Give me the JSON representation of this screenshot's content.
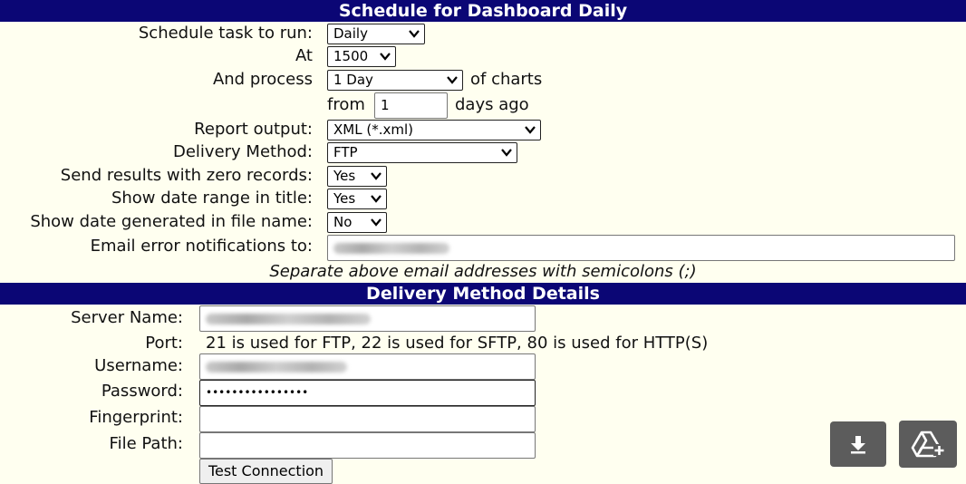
{
  "schedule": {
    "title": "Schedule for Dashboard Daily",
    "task_label": "Schedule task to run:",
    "task_value": "Daily",
    "at_label": "At",
    "at_value": "1500",
    "process_label": "And process",
    "process_value": "1 Day",
    "process_suffix": "of charts",
    "from_label": "from",
    "from_value": "1",
    "from_suffix": "days ago",
    "output_label": "Report output:",
    "output_value": "XML (*.xml)",
    "delivery_label": "Delivery Method:",
    "delivery_value": "FTP",
    "zero_label": "Send results with zero records:",
    "zero_value": "Yes",
    "range_label": "Show date range in title:",
    "range_value": "Yes",
    "generated_label": "Show date generated in file name:",
    "generated_value": "No",
    "email_label": "Email error notifications to:",
    "note": "Separate above email addresses with semicolons (;)"
  },
  "delivery": {
    "title": "Delivery Method Details",
    "server_label": "Server Name:",
    "port_label": "Port:",
    "port_text": "21 is used for FTP, 22 is used for SFTP, 80 is used for HTTP(S)",
    "username_label": "Username:",
    "password_label": "Password:",
    "password_value": "••••••••••••••••",
    "fingerprint_label": "Fingerprint:",
    "filepath_label": "File Path:",
    "test_button": "Test Connection"
  },
  "floating": {
    "download_icon": "download-arrow-icon",
    "drive_icon": "drive-add-icon",
    "color": "#5c5c5c"
  },
  "colors": {
    "header": "#0b0675",
    "background": "#fffff0"
  }
}
